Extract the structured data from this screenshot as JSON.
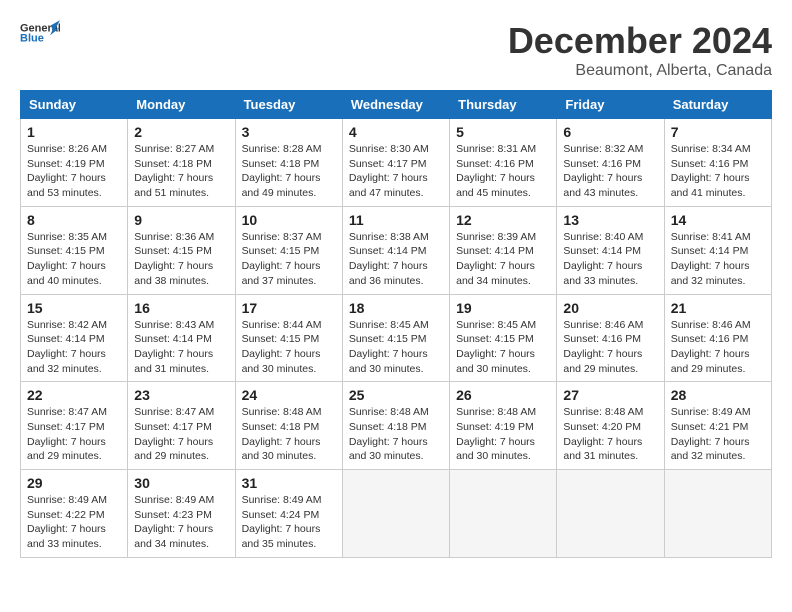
{
  "logo": {
    "line1": "General",
    "line2": "Blue"
  },
  "title": "December 2024",
  "location": "Beaumont, Alberta, Canada",
  "days_of_week": [
    "Sunday",
    "Monday",
    "Tuesday",
    "Wednesday",
    "Thursday",
    "Friday",
    "Saturday"
  ],
  "weeks": [
    [
      {
        "day": "1",
        "sunrise": "8:26 AM",
        "sunset": "4:19 PM",
        "daylight": "7 hours and 53 minutes."
      },
      {
        "day": "2",
        "sunrise": "8:27 AM",
        "sunset": "4:18 PM",
        "daylight": "7 hours and 51 minutes."
      },
      {
        "day": "3",
        "sunrise": "8:28 AM",
        "sunset": "4:18 PM",
        "daylight": "7 hours and 49 minutes."
      },
      {
        "day": "4",
        "sunrise": "8:30 AM",
        "sunset": "4:17 PM",
        "daylight": "7 hours and 47 minutes."
      },
      {
        "day": "5",
        "sunrise": "8:31 AM",
        "sunset": "4:16 PM",
        "daylight": "7 hours and 45 minutes."
      },
      {
        "day": "6",
        "sunrise": "8:32 AM",
        "sunset": "4:16 PM",
        "daylight": "7 hours and 43 minutes."
      },
      {
        "day": "7",
        "sunrise": "8:34 AM",
        "sunset": "4:16 PM",
        "daylight": "7 hours and 41 minutes."
      }
    ],
    [
      {
        "day": "8",
        "sunrise": "8:35 AM",
        "sunset": "4:15 PM",
        "daylight": "7 hours and 40 minutes."
      },
      {
        "day": "9",
        "sunrise": "8:36 AM",
        "sunset": "4:15 PM",
        "daylight": "7 hours and 38 minutes."
      },
      {
        "day": "10",
        "sunrise": "8:37 AM",
        "sunset": "4:15 PM",
        "daylight": "7 hours and 37 minutes."
      },
      {
        "day": "11",
        "sunrise": "8:38 AM",
        "sunset": "4:14 PM",
        "daylight": "7 hours and 36 minutes."
      },
      {
        "day": "12",
        "sunrise": "8:39 AM",
        "sunset": "4:14 PM",
        "daylight": "7 hours and 34 minutes."
      },
      {
        "day": "13",
        "sunrise": "8:40 AM",
        "sunset": "4:14 PM",
        "daylight": "7 hours and 33 minutes."
      },
      {
        "day": "14",
        "sunrise": "8:41 AM",
        "sunset": "4:14 PM",
        "daylight": "7 hours and 32 minutes."
      }
    ],
    [
      {
        "day": "15",
        "sunrise": "8:42 AM",
        "sunset": "4:14 PM",
        "daylight": "7 hours and 32 minutes."
      },
      {
        "day": "16",
        "sunrise": "8:43 AM",
        "sunset": "4:14 PM",
        "daylight": "7 hours and 31 minutes."
      },
      {
        "day": "17",
        "sunrise": "8:44 AM",
        "sunset": "4:15 PM",
        "daylight": "7 hours and 30 minutes."
      },
      {
        "day": "18",
        "sunrise": "8:45 AM",
        "sunset": "4:15 PM",
        "daylight": "7 hours and 30 minutes."
      },
      {
        "day": "19",
        "sunrise": "8:45 AM",
        "sunset": "4:15 PM",
        "daylight": "7 hours and 30 minutes."
      },
      {
        "day": "20",
        "sunrise": "8:46 AM",
        "sunset": "4:16 PM",
        "daylight": "7 hours and 29 minutes."
      },
      {
        "day": "21",
        "sunrise": "8:46 AM",
        "sunset": "4:16 PM",
        "daylight": "7 hours and 29 minutes."
      }
    ],
    [
      {
        "day": "22",
        "sunrise": "8:47 AM",
        "sunset": "4:17 PM",
        "daylight": "7 hours and 29 minutes."
      },
      {
        "day": "23",
        "sunrise": "8:47 AM",
        "sunset": "4:17 PM",
        "daylight": "7 hours and 29 minutes."
      },
      {
        "day": "24",
        "sunrise": "8:48 AM",
        "sunset": "4:18 PM",
        "daylight": "7 hours and 30 minutes."
      },
      {
        "day": "25",
        "sunrise": "8:48 AM",
        "sunset": "4:18 PM",
        "daylight": "7 hours and 30 minutes."
      },
      {
        "day": "26",
        "sunrise": "8:48 AM",
        "sunset": "4:19 PM",
        "daylight": "7 hours and 30 minutes."
      },
      {
        "day": "27",
        "sunrise": "8:48 AM",
        "sunset": "4:20 PM",
        "daylight": "7 hours and 31 minutes."
      },
      {
        "day": "28",
        "sunrise": "8:49 AM",
        "sunset": "4:21 PM",
        "daylight": "7 hours and 32 minutes."
      }
    ],
    [
      {
        "day": "29",
        "sunrise": "8:49 AM",
        "sunset": "4:22 PM",
        "daylight": "7 hours and 33 minutes."
      },
      {
        "day": "30",
        "sunrise": "8:49 AM",
        "sunset": "4:23 PM",
        "daylight": "7 hours and 34 minutes."
      },
      {
        "day": "31",
        "sunrise": "8:49 AM",
        "sunset": "4:24 PM",
        "daylight": "7 hours and 35 minutes."
      },
      null,
      null,
      null,
      null
    ]
  ]
}
